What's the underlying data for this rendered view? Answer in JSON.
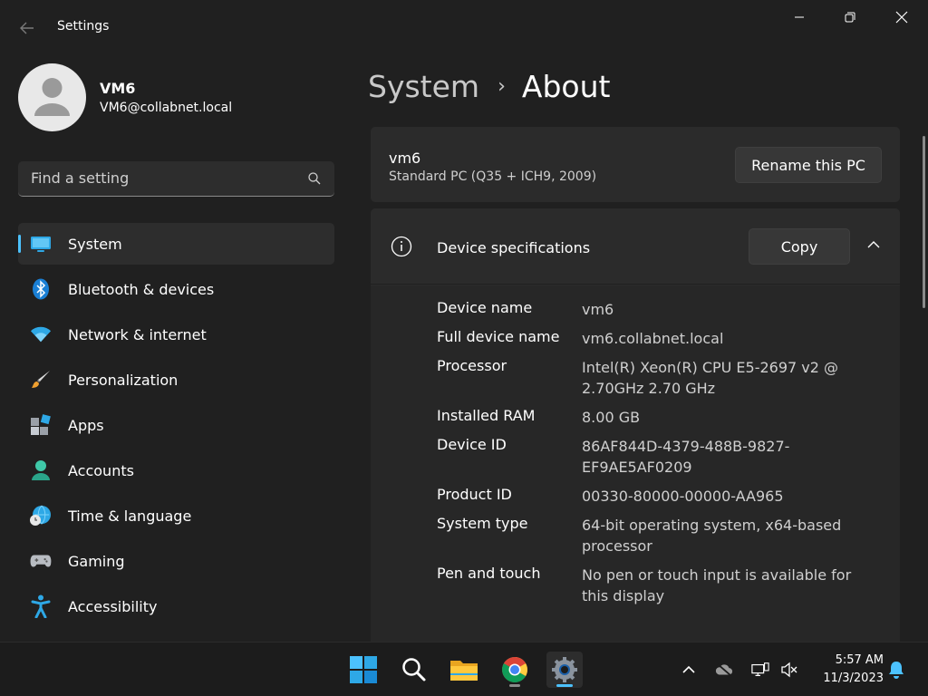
{
  "window": {
    "title": "Settings"
  },
  "user": {
    "name": "VM6",
    "email": "VM6@collabnet.local"
  },
  "search": {
    "placeholder": "Find a setting"
  },
  "sidebar": {
    "items": [
      {
        "label": "System",
        "icon": "system-icon",
        "active": true
      },
      {
        "label": "Bluetooth & devices",
        "icon": "bluetooth-icon",
        "active": false
      },
      {
        "label": "Network & internet",
        "icon": "wifi-icon",
        "active": false
      },
      {
        "label": "Personalization",
        "icon": "brush-icon",
        "active": false
      },
      {
        "label": "Apps",
        "icon": "apps-icon",
        "active": false
      },
      {
        "label": "Accounts",
        "icon": "accounts-icon",
        "active": false
      },
      {
        "label": "Time & language",
        "icon": "globe-clock-icon",
        "active": false
      },
      {
        "label": "Gaming",
        "icon": "gamepad-icon",
        "active": false
      },
      {
        "label": "Accessibility",
        "icon": "accessibility-icon",
        "active": false
      }
    ]
  },
  "breadcrumb": {
    "parent": "System",
    "separator": "›",
    "current": "About"
  },
  "pc": {
    "name": "vm6",
    "model": "Standard PC (Q35 + ICH9, 2009)",
    "rename_label": "Rename this PC"
  },
  "specs": {
    "title": "Device specifications",
    "copy_label": "Copy",
    "rows": [
      {
        "label": "Device name",
        "value": "vm6"
      },
      {
        "label": "Full device name",
        "value": "vm6.collabnet.local"
      },
      {
        "label": "Processor",
        "value": "Intel(R) Xeon(R) CPU E5-2697 v2 @ 2.70GHz   2.70 GHz"
      },
      {
        "label": "Installed RAM",
        "value": "8.00 GB"
      },
      {
        "label": "Device ID",
        "value": "86AF844D-4379-488B-9827-EF9AE5AF0209"
      },
      {
        "label": "Product ID",
        "value": "00330-80000-00000-AA965"
      },
      {
        "label": "System type",
        "value": "64-bit operating system, x64-based processor"
      },
      {
        "label": "Pen and touch",
        "value": "No pen or touch input is available for this display"
      }
    ]
  },
  "taskbar": {
    "apps": [
      {
        "icon": "start-icon"
      },
      {
        "icon": "search-icon"
      },
      {
        "icon": "file-explorer-icon"
      },
      {
        "icon": "chrome-icon"
      },
      {
        "icon": "settings-icon"
      }
    ],
    "time": "5:57 AM",
    "date": "11/3/2023"
  },
  "colors": {
    "accent": "#4cc2ff",
    "background": "#202020",
    "card": "#2b2b2b"
  }
}
